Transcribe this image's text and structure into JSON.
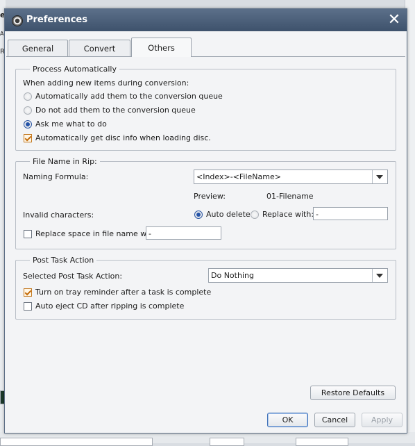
{
  "window": {
    "title": "Preferences"
  },
  "tabs": [
    {
      "label": "General"
    },
    {
      "label": "Convert"
    },
    {
      "label": "Others",
      "active": true
    }
  ],
  "process": {
    "title": "Process Automatically",
    "intro": "When adding new items during conversion:",
    "options": [
      {
        "label": "Automatically add them to the conversion queue",
        "checked": false
      },
      {
        "label": "Do not add them to the conversion queue",
        "checked": false
      },
      {
        "label": "Ask me what to do",
        "checked": true
      }
    ],
    "disc_info": {
      "label": "Automatically get disc info when loading disc.",
      "checked": true
    }
  },
  "filename": {
    "title": "File Name in Rip:",
    "formula_label": "Naming Formula:",
    "formula_value": "<Index>-<FileName>",
    "preview_label": "Preview:",
    "preview_value": "01-Filename",
    "invalid_label": "Invalid characters:",
    "auto_delete": "Auto delete",
    "replace_with": "Replace with:",
    "replace_with_value": "-",
    "replace_space_label": "Replace space in file name with:",
    "replace_space_value": "-"
  },
  "post_task": {
    "title": "Post Task Action",
    "selected_label": "Selected Post Task Action:",
    "selected_value": "Do Nothing",
    "tray_reminder": {
      "label": "Turn on tray reminder after a task is complete",
      "checked": true
    },
    "auto_eject": {
      "label": "Auto eject CD after ripping is complete",
      "checked": false
    }
  },
  "buttons": {
    "restore": "Restore Defaults",
    "ok": "OK",
    "cancel": "Cancel",
    "apply": "Apply"
  },
  "colors": {
    "titlebar": "#4a5e78",
    "accent_check": "#c56d0b",
    "radio_selected": "#2453a8"
  },
  "background": {
    "fragments": [
      "e",
      "A",
      "R"
    ]
  }
}
